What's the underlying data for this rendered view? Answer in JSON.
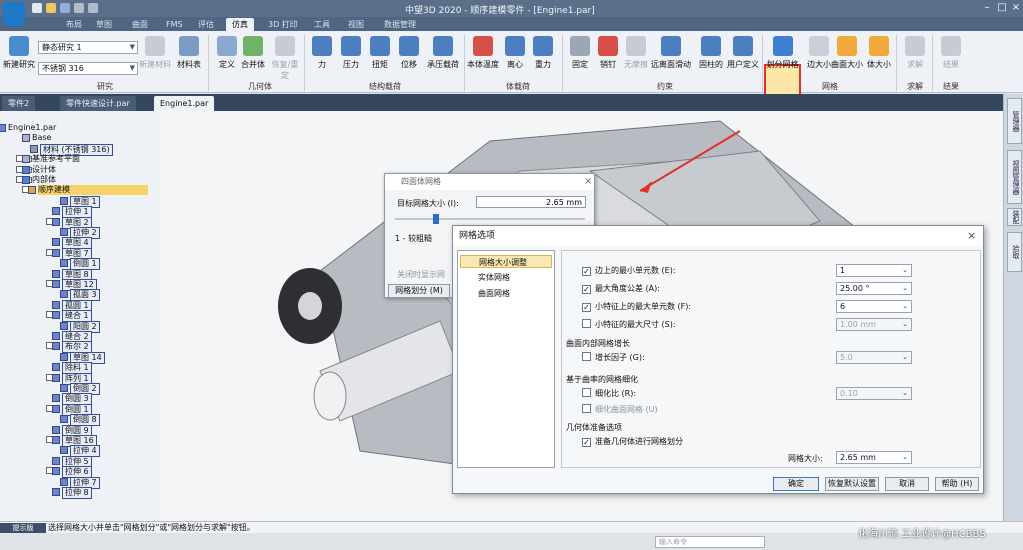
{
  "titlebar": {
    "title": "中望3D 2020 - 顺序建模零件 - [Engine1.par]"
  },
  "menu": {
    "tabs": [
      "布局",
      "草图",
      "曲面",
      "FMS",
      "评估",
      "仿真",
      "3D 打印",
      "工具",
      "视图",
      "数据管理"
    ],
    "active": "仿真"
  },
  "ribbon": {
    "study": {
      "name": "静态研究 1",
      "material": "不锈钢 316",
      "new_study": "新建研究",
      "new_mat": "新建材料",
      "mat_table": "材料表",
      "group": "研究"
    },
    "geometry": {
      "items": [
        "定义",
        "合并体",
        "恢复/重定"
      ],
      "group": "几何体"
    },
    "structural": {
      "items": [
        "力",
        "压力",
        "扭矩",
        "位移",
        "承压载荷"
      ],
      "group": "结构载荷"
    },
    "body_load": {
      "items": [
        "本体温度",
        "离心",
        "重力"
      ],
      "group": "体载荷"
    },
    "constraints": {
      "items": [
        "固定",
        "销钉",
        "无摩擦",
        "远离面滑动",
        "固柱的",
        "用户定义"
      ],
      "group": "约束"
    },
    "mesh": {
      "items": [
        "划分网格",
        "边大小",
        "曲面大小",
        "体大小"
      ],
      "group": "网格"
    },
    "solve": {
      "items": [
        "求解"
      ],
      "group": "求解"
    },
    "result": {
      "items": [
        "结果"
      ],
      "group": "结果"
    }
  },
  "doctabs": [
    "零件2",
    "零件快速设计.par",
    "Engine1.par"
  ],
  "tree": [
    {
      "label": "Engine1.par"
    },
    {
      "label": "Base"
    },
    {
      "label": "材料 (不锈钢 316)"
    },
    {
      "label": "基准参考平面"
    },
    {
      "label": "设计体"
    },
    {
      "label": "内部体"
    },
    {
      "label": "顺序建模"
    },
    {
      "label": "草图 1"
    },
    {
      "label": "拉伸 1"
    },
    {
      "label": "草图 2"
    },
    {
      "label": "拉伸 2"
    },
    {
      "label": "草图 4"
    },
    {
      "label": "草图 7"
    },
    {
      "label": "倒圆 1"
    },
    {
      "label": "草图 8"
    },
    {
      "label": "草图 12"
    },
    {
      "label": "孤面 3"
    },
    {
      "label": "孤圆 1"
    },
    {
      "label": "缝合 1"
    },
    {
      "label": "阳圆 2"
    },
    {
      "label": "缝合 2"
    },
    {
      "label": "布尔 2"
    },
    {
      "label": "草图 14"
    },
    {
      "label": "除料 1"
    },
    {
      "label": "阵列 1"
    },
    {
      "label": "倒圆 2"
    },
    {
      "label": "倒圆 3"
    },
    {
      "label": "倒圆 1"
    },
    {
      "label": "倒圆 8"
    },
    {
      "label": "倒圆 9"
    },
    {
      "label": "草图 16"
    },
    {
      "label": "拉伸 4"
    },
    {
      "label": "拉伸 5"
    },
    {
      "label": "拉伸 6"
    },
    {
      "label": "拉伸 7"
    },
    {
      "label": "拉伸 8"
    }
  ],
  "dialog_tet": {
    "title": "四面体网格",
    "target_label": "目标网格大小 (I):",
    "target_value": "2.65 mm",
    "scale_label": "1 - 较粗糙",
    "close_show": "关闭时显示网",
    "mesh_btn": "网格划分 (M)"
  },
  "dialog_opts": {
    "title": "网格选项",
    "nav": [
      "网格大小调整",
      "实体网格",
      "曲面网格"
    ],
    "nav_selected": "网格大小调整",
    "rows": [
      {
        "label": "边上的最小单元数 (E):",
        "value": "1",
        "checked": true
      },
      {
        "label": "最大角度公差 (A):",
        "value": "25.00 °",
        "checked": true
      },
      {
        "label": "小特征上的最大单元数 (F):",
        "value": "6",
        "checked": true
      },
      {
        "label": "小特征的最大尺寸 (S):",
        "value": "1.00 mm",
        "checked": false
      }
    ],
    "sec_growth": "曲面内部网格增长",
    "growth": {
      "label": "增长因子 (G):",
      "value": "5.0"
    },
    "sec_curv": "基于曲率的网格细化",
    "curv_ratio": {
      "label": "细化比 (R):",
      "value": "0.10"
    },
    "curv_surface": "细化曲面网格 (U)",
    "sec_geom": "几何体准备选项",
    "prepare": "准备几何体进行网格划分",
    "mesh_size": {
      "label": "网格大小:",
      "value": "2.65 mm"
    },
    "buttons": [
      "确定",
      "恢复默认设置",
      "取消",
      "帮助 (H)"
    ]
  },
  "status": {
    "tag": "提示版",
    "hint": "选择网格大小并单击\"网格划分\"或\"网格划分与求解\"按钮。",
    "cmd": "输入命令",
    "watermark": "化海川流 工业设计@HCBBS"
  },
  "right_panel": [
    "管理器",
    "视图管理器",
    "装配",
    "拾取"
  ],
  "colors": {
    "accent": "#e0312a",
    "ribbon": "#eef1f5",
    "title": "#5b6f8a",
    "selected": "#f9e8b2"
  }
}
